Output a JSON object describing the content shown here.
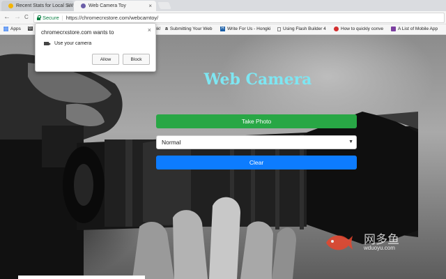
{
  "tabs": [
    {
      "label": "Recent Stats for Local SW",
      "active": false
    },
    {
      "label": "Web Camera Toy",
      "active": true
    }
  ],
  "toolbar": {
    "back": "←",
    "forward": "→",
    "reload": "C",
    "secure_label": "Secure",
    "url": "https://chromecrxstore.com/webcamtoy/"
  },
  "bookmarks": [
    {
      "label": "Apps",
      "icon": "apps-grid-icon"
    },
    {
      "label": "G",
      "icon": "g-icon"
    },
    {
      "label": "nk!",
      "icon": ""
    },
    {
      "label": "Submitting Your Web",
      "icon": "amazon-icon"
    },
    {
      "label": "Write For Us - Hongki",
      "icon": "h-icon"
    },
    {
      "label": "Using Flash Builder 4",
      "icon": "doc-icon"
    },
    {
      "label": "How to quickly conve",
      "icon": "red-circle-icon"
    },
    {
      "label": "A List of Mobile App",
      "icon": "puzzle-icon"
    }
  ],
  "popup": {
    "title": "chromecrxstore.com wants to",
    "permission": "Use your camera",
    "allow": "Allow",
    "block": "Block",
    "close": "×"
  },
  "page": {
    "title": "Web Camera",
    "take_photo": "Take Photo",
    "filter_value": "Normal",
    "clear": "Clear"
  },
  "watermark": {
    "cn": "网多鱼",
    "en": "wduoyu.com"
  },
  "colors": {
    "take_photo": "#28a745",
    "clear": "#0d7cff",
    "title": "#7ee6f2",
    "secure": "#0b8043"
  }
}
